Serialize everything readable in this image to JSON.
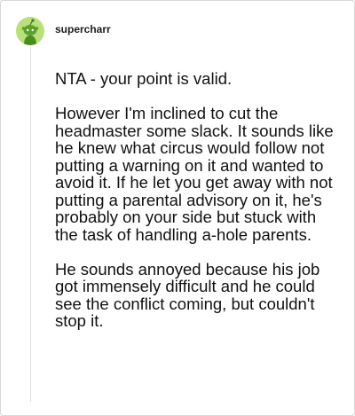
{
  "comment": {
    "author": "supercharr",
    "paragraphs": [
      "NTA - your point is valid.",
      "However I'm inclined to cut the headmaster some slack. It sounds like he knew what circus would follow not putting a warning on it and wanted to avoid it. If he let you get away with not putting a parental advisory on it, he's probably on your side but stuck with the task of handling a-hole parents.",
      "He sounds annoyed because his job got immensely difficult and he could see the conflict coming, but couldn't stop it."
    ]
  },
  "avatar": {
    "icon": "snoo-avatar-icon",
    "background_color": "#b9e07b",
    "figure_color": "#4a8d1f"
  }
}
